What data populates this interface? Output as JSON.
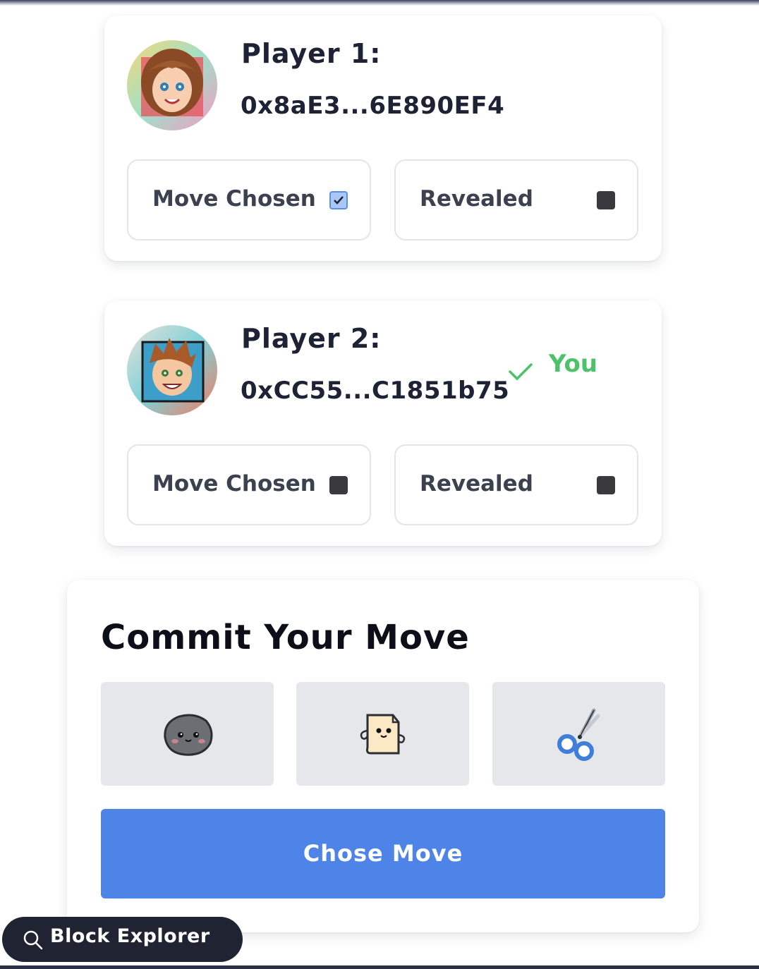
{
  "players": [
    {
      "label": "Player 1:",
      "address": "0x8aE3...6E890EF4",
      "avatar": "girl-avatar",
      "is_you": false,
      "you_label": "",
      "move_chosen_label": "Move Chosen",
      "move_chosen": true,
      "revealed_label": "Revealed",
      "revealed": false
    },
    {
      "label": "Player 2:",
      "address": "0xCC55...C1851b75",
      "avatar": "boy-avatar",
      "is_you": true,
      "you_label": "You",
      "move_chosen_label": "Move Chosen",
      "move_chosen": false,
      "revealed_label": "Revealed",
      "revealed": false
    }
  ],
  "commit": {
    "title": "Commit Your Move",
    "moves": [
      {
        "name": "rock",
        "icon": "rock-icon"
      },
      {
        "name": "paper",
        "icon": "paper-icon"
      },
      {
        "name": "scissors",
        "icon": "scissors-icon"
      }
    ],
    "submit_label": "Chose Move"
  },
  "explorer": {
    "label": "Block Explorer",
    "icon": "search-icon"
  },
  "colors": {
    "accent_blue": "#4e84e8",
    "you_green": "#4cc36a",
    "dark": "#1f2332"
  }
}
